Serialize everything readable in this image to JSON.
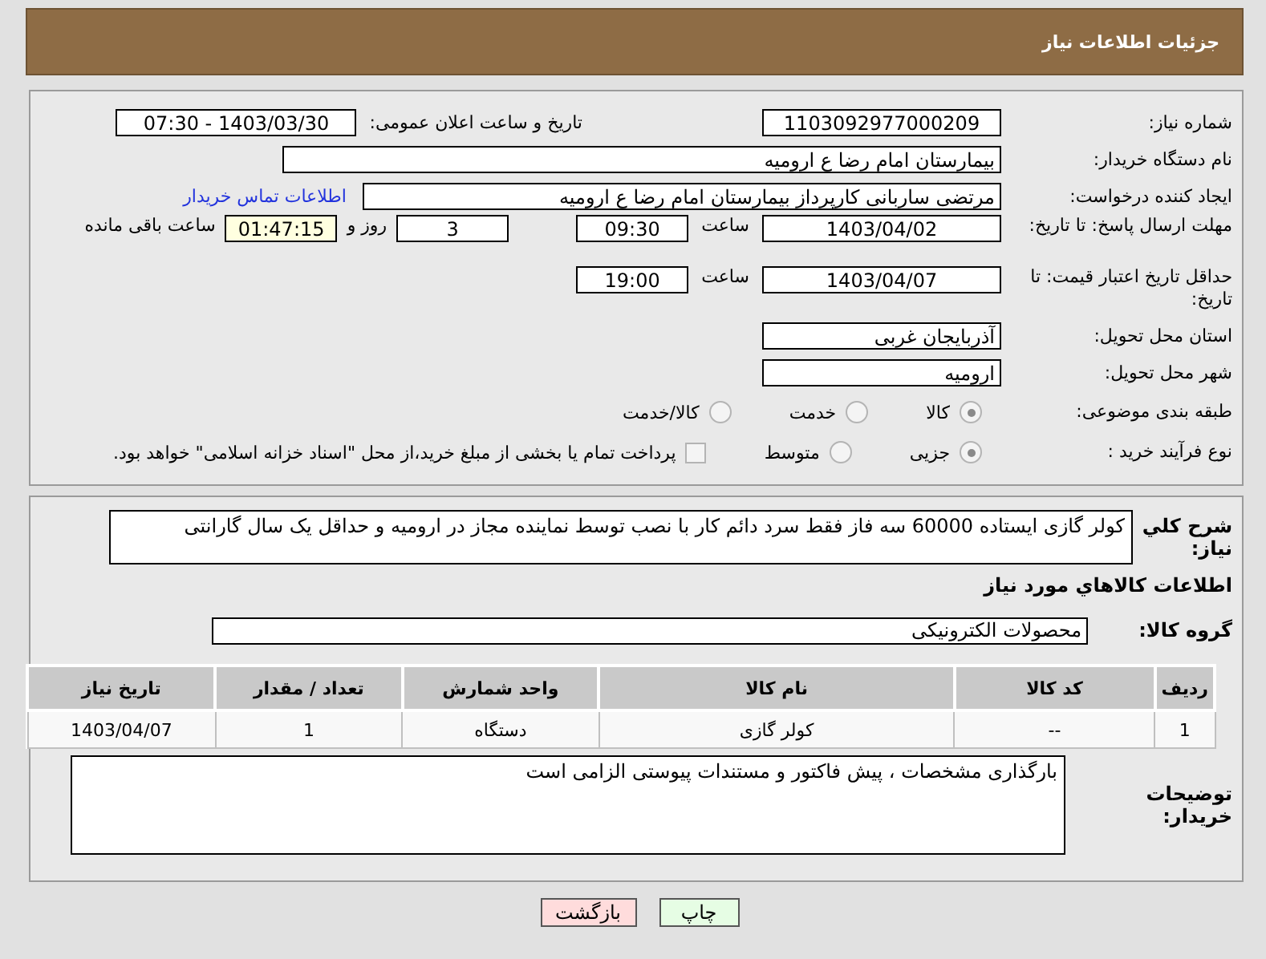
{
  "header": {
    "title": "جزئیات اطلاعات نیاز"
  },
  "need_number": {
    "label": "شماره نیاز:",
    "value": "1103092977000209"
  },
  "announce_date": {
    "label": "تاریخ و ساعت اعلان عمومی:",
    "value": "1403/03/30 - 07:30"
  },
  "buyer_org": {
    "label": "نام دستگاه خریدار:",
    "value": "بیمارستان امام رضا  ع  ارومیه"
  },
  "requester": {
    "label": "ایجاد کننده درخواست:",
    "value": "مرتضی ساربانی کارپرداز بیمارستان امام رضا  ع  ارومیه",
    "link": "اطلاعات تماس خریدار"
  },
  "reply_deadline": {
    "label": "مهلت ارسال پاسخ: تا تاریخ:",
    "date": "1403/04/02",
    "time_label": "ساعت",
    "time": "09:30",
    "days": "3",
    "days_label": "روز و",
    "remaining": "01:47:15",
    "remaining_label": "ساعت باقی مانده"
  },
  "price_validity": {
    "label": "حداقل تاریخ اعتبار قیمت: تا تاریخ:",
    "date": "1403/04/07",
    "time_label": "ساعت",
    "time": "19:00"
  },
  "province": {
    "label": "استان محل تحویل:",
    "value": "آذربایجان غربی"
  },
  "city": {
    "label": "شهر محل تحویل:",
    "value": "ارومیه"
  },
  "subject_category": {
    "label": "طبقه بندی موضوعی:",
    "options": [
      {
        "label": "کالا",
        "selected": true
      },
      {
        "label": "خدمت",
        "selected": false
      },
      {
        "label": "کالا/خدمت",
        "selected": false
      }
    ]
  },
  "purchase_process": {
    "label": "نوع فرآیند خرید :",
    "options": [
      {
        "label": "جزیی",
        "selected": true
      },
      {
        "label": "متوسط",
        "selected": false
      }
    ],
    "treasury": {
      "label": "پرداخت تمام یا بخشی از مبلغ خرید،از محل \"اسناد خزانه اسلامی\" خواهد بود.",
      "checked": false
    }
  },
  "description": {
    "label": "شرح کلي نياز:",
    "value": "کولر گازی ایستاده 60000 سه فاز فقط سرد دائم کار با نصب توسط نماینده مجاز در ارومیه و حداقل یک سال گارانتی"
  },
  "goods_title": "اطلاعات کالاهاي مورد نياز",
  "goods_group": {
    "label": "گروه کالا:",
    "value": "محصولات الکترونیکی"
  },
  "table": {
    "columns": [
      "رديف",
      "کد کالا",
      "نام کالا",
      "واحد شمارش",
      "تعداد / مقدار",
      "تاریخ نیاز"
    ],
    "rows": [
      [
        "1",
        "--",
        "کولر گازی",
        "دستگاه",
        "1",
        "1403/04/07"
      ]
    ]
  },
  "buyer_notes": {
    "label": "توضیحات خریدار:",
    "value": "بارگذاری مشخصات ، پیش فاکتور و مستندات پیوستی الزامی است"
  },
  "buttons": [
    {
      "label": "چاپ",
      "kind": "print"
    },
    {
      "label": "بازگشت",
      "kind": "back"
    }
  ]
}
